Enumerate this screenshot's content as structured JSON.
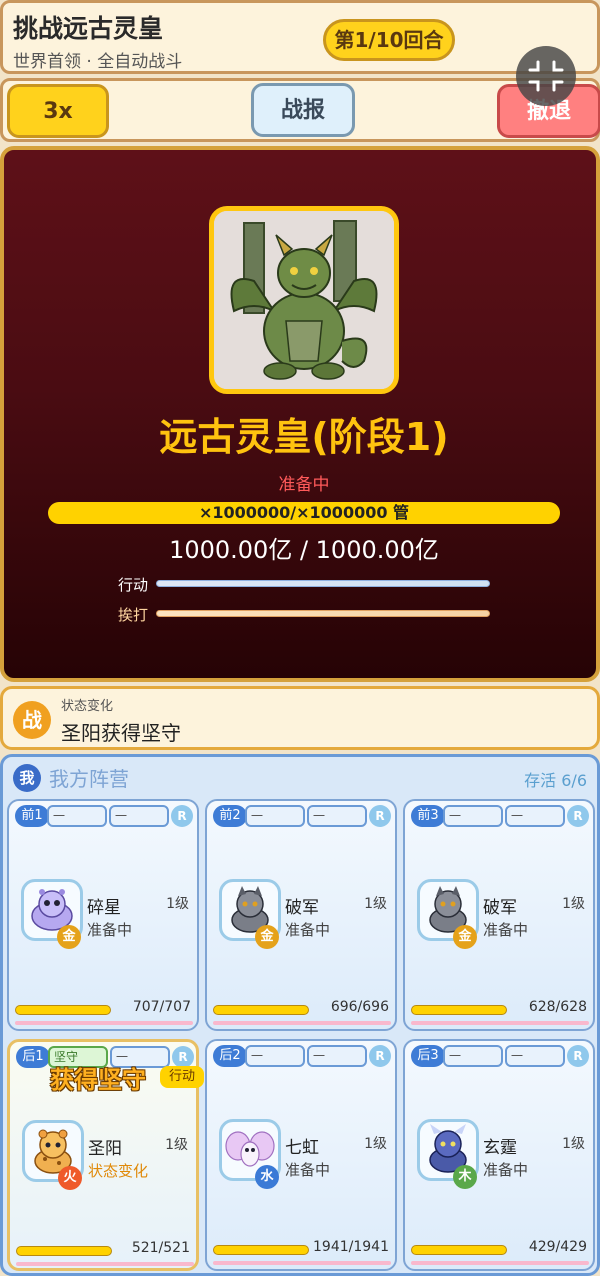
{
  "header": {
    "title": "挑战远古灵皇",
    "subtitle": "世界首领 · 全自动战斗",
    "round": "第1/10回合"
  },
  "toolbar": {
    "speed_label": "3x",
    "report_label": "战报",
    "retreat_label": "撤退"
  },
  "boss": {
    "name": "远古灵皇(阶段1)",
    "status": "准备中",
    "hp_bar_text": "×1000000/×1000000 管",
    "hp_text": "1000.00亿 / 1000.00亿",
    "action_label": "行动",
    "hit_label": "挨打",
    "hp_fraction": 1.0
  },
  "status_change": {
    "icon_text": "战",
    "label": "状态变化",
    "text": "圣阳获得坚守"
  },
  "team": {
    "icon_text": "我",
    "title": "我方阵营",
    "alive": "存活 6/6",
    "units": [
      {
        "pos": "前1",
        "slot1": "一",
        "slot2": "一",
        "rarity": "R",
        "name": "碎星",
        "level": "1级",
        "status": "准备中",
        "element": "金",
        "hp": "707/707",
        "hp_fraction": 1.0
      },
      {
        "pos": "前2",
        "slot1": "一",
        "slot2": "一",
        "rarity": "R",
        "name": "破军",
        "level": "1级",
        "status": "准备中",
        "element": "金",
        "hp": "696/696",
        "hp_fraction": 1.0
      },
      {
        "pos": "前3",
        "slot1": "一",
        "slot2": "一",
        "rarity": "R",
        "name": "破军",
        "level": "1级",
        "status": "准备中",
        "element": "金",
        "hp": "628/628",
        "hp_fraction": 1.0
      },
      {
        "pos": "后1",
        "slot1": "坚守",
        "slot2": "一",
        "rarity": "R",
        "name": "圣阳",
        "level": "1级",
        "status": "状态变化",
        "element": "火",
        "hp": "521/521",
        "hp_fraction": 1.0,
        "gain_text": "获得坚守",
        "action_tag": "行动"
      },
      {
        "pos": "后2",
        "slot1": "一",
        "slot2": "一",
        "rarity": "R",
        "name": "七虹",
        "level": "1级",
        "status": "准备中",
        "element": "水",
        "hp": "1941/1941",
        "hp_fraction": 1.0
      },
      {
        "pos": "后3",
        "slot1": "一",
        "slot2": "一",
        "rarity": "R",
        "name": "玄霆",
        "level": "1级",
        "status": "准备中",
        "element": "木",
        "hp": "429/429",
        "hp_fraction": 1.0
      }
    ]
  },
  "colors": {
    "gold": "#ffd21c",
    "boss_bg": "#4a0c12",
    "team_bg": "#d9e8f8",
    "metal": "#e5a21a",
    "fire": "#ef5a2a",
    "water": "#3a7ad6",
    "wood": "#5aa84a"
  }
}
